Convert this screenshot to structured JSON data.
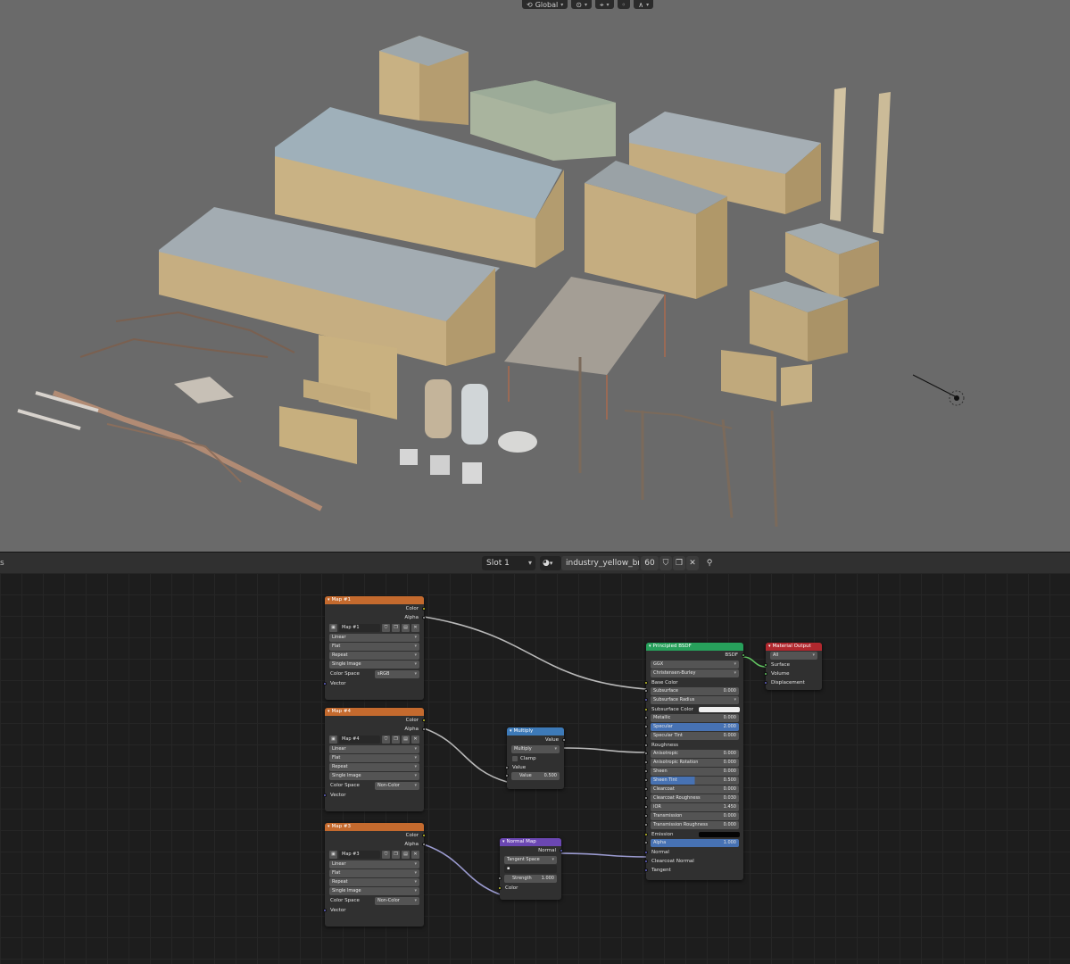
{
  "viewport": {
    "transform_orientation": "Global",
    "colors": {
      "background": "#6a6a6a",
      "building_wall": "#c4ad7c",
      "roof": "#a9b2b7"
    }
  },
  "node_header": {
    "left_glyph": "s",
    "slot": "Slot 1",
    "material_name": "industry_yellow_bri..",
    "users": "60"
  },
  "nodes": {
    "map1": {
      "title": "Map #1",
      "color": "Color",
      "alpha": "Alpha",
      "image": "Map #1",
      "interpolation": "Linear",
      "projection": "Flat",
      "extension": "Repeat",
      "source": "Single Image",
      "colorspace_label": "Color Space",
      "colorspace": "sRGB",
      "vector": "Vector"
    },
    "map4": {
      "title": "Map #4",
      "color": "Color",
      "alpha": "Alpha",
      "image": "Map #4",
      "interpolation": "Linear",
      "projection": "Flat",
      "extension": "Repeat",
      "source": "Single Image",
      "colorspace_label": "Color Space",
      "colorspace": "Non-Color",
      "vector": "Vector"
    },
    "map3": {
      "title": "Map #3",
      "color": "Color",
      "alpha": "Alpha",
      "image": "Map #3",
      "interpolation": "Linear",
      "projection": "Flat",
      "extension": "Repeat",
      "source": "Single Image",
      "colorspace_label": "Color Space",
      "colorspace": "Non-Color",
      "vector": "Vector"
    },
    "multiply": {
      "title": "Multiply",
      "value_out": "Value",
      "operation": "Multiply",
      "clamp": "Clamp",
      "value_in": "Value",
      "value_label": "Value",
      "value": "0.500"
    },
    "normalmap": {
      "title": "Normal Map",
      "normal_out": "Normal",
      "space": "Tangent Space",
      "strength_label": "Strength",
      "strength": "1.000",
      "color_in": "Color"
    },
    "bsdf": {
      "title": "Principled BSDF",
      "out": "BSDF",
      "distribution": "GGX",
      "sss_method": "Christensen-Burley",
      "base_color": "Base Color",
      "rows": [
        {
          "label": "Subsurface",
          "value": "0.000"
        },
        {
          "label": "Subsurface Radius",
          "value": ""
        },
        {
          "label": "Subsurface Color",
          "value": ""
        },
        {
          "label": "Metallic",
          "value": "0.000"
        },
        {
          "label": "Specular",
          "value": "2.000"
        },
        {
          "label": "Specular Tint",
          "value": "0.000"
        },
        {
          "label": "Roughness",
          "value": ""
        },
        {
          "label": "Anisotropic",
          "value": "0.000"
        },
        {
          "label": "Anisotropic Rotation",
          "value": "0.000"
        },
        {
          "label": "Sheen",
          "value": "0.000"
        },
        {
          "label": "Sheen Tint",
          "value": "0.500"
        },
        {
          "label": "Clearcoat",
          "value": "0.000"
        },
        {
          "label": "Clearcoat Roughness",
          "value": "0.030"
        },
        {
          "label": "IOR",
          "value": "1.450"
        },
        {
          "label": "Transmission",
          "value": "0.000"
        },
        {
          "label": "Transmission Roughness",
          "value": "0.000"
        },
        {
          "label": "Emission",
          "value": ""
        },
        {
          "label": "Alpha",
          "value": "1.000"
        },
        {
          "label": "Normal",
          "value": ""
        },
        {
          "label": "Clearcoat Normal",
          "value": ""
        },
        {
          "label": "Tangent",
          "value": ""
        }
      ]
    },
    "output": {
      "title": "Material Output",
      "target": "All",
      "surface": "Surface",
      "volume": "Volume",
      "displacement": "Displacement"
    }
  },
  "colors": {
    "texture_header": "#c46a2e",
    "math_header": "#3d7ab8",
    "vector_header": "#6b47b3",
    "shader_header": "#27a05b",
    "output_header": "#b1282e",
    "slider_fill": "#4772b3"
  }
}
